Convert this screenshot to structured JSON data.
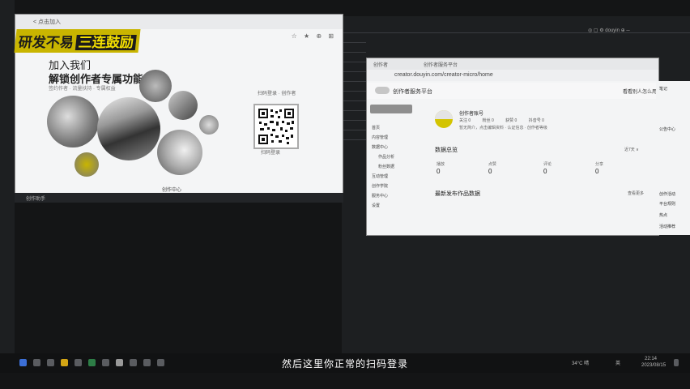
{
  "background_windows": {
    "left_status": "…"
  },
  "left_browser": {
    "tab": "< 点击加入",
    "toolbar": "☆ ★ ⊕ ⊞",
    "badge_main": "研发不易",
    "badge_hl": "三连鼓励",
    "join_title": "加入我们",
    "join_sub": "解锁创作者专属功能",
    "join_desc": "签约作者 · 流量扶持 · 专属权益",
    "qr_label": "扫码登录 · 创作者",
    "qr_label2": "扫码登录",
    "url": "创作中心",
    "status": "创作助手"
  },
  "right_browser": {
    "tab1": "创作者",
    "tab2": "创作者服务平台",
    "url": "creator.douyin.com/creator-micro/home",
    "page_title": "创作者服务平台",
    "header_btn": "看看别人怎么用",
    "sidebar": [
      "首页",
      "内容管理",
      "数据中心",
      "作品分析",
      "粉丝数据",
      "互动管理",
      "创作学院",
      "服务中心",
      "设置"
    ],
    "user_name": "创作者账号",
    "user_stats": [
      "关注 0",
      "粉丝 0",
      "获赞 0",
      "抖音号 0"
    ],
    "user_desc": "暂无简介，点击编辑资料 · 认证信息 · 创作者等级",
    "section_data": "数据总览",
    "range": "近7天 ∨",
    "stats": [
      {
        "label": "播放",
        "value": "0"
      },
      {
        "label": "点赞",
        "value": "0"
      },
      {
        "label": "评论",
        "value": "0"
      },
      {
        "label": "分享",
        "value": "0"
      }
    ],
    "section_recent": "最新发布作品数据",
    "more": "查看更多",
    "right_panel": [
      "笔记",
      "公告中心",
      "创作活动",
      "平台规则",
      "热点",
      "活动推荐"
    ]
  },
  "top_strip": "◎ ▢ ⚙ douyin ⊕ ─",
  "caption": "然后这里你正常的扫码登录",
  "tray": {
    "weather": "34°C 晴",
    "ime": "英",
    "time": "22:14",
    "date": "2023/08/15"
  }
}
